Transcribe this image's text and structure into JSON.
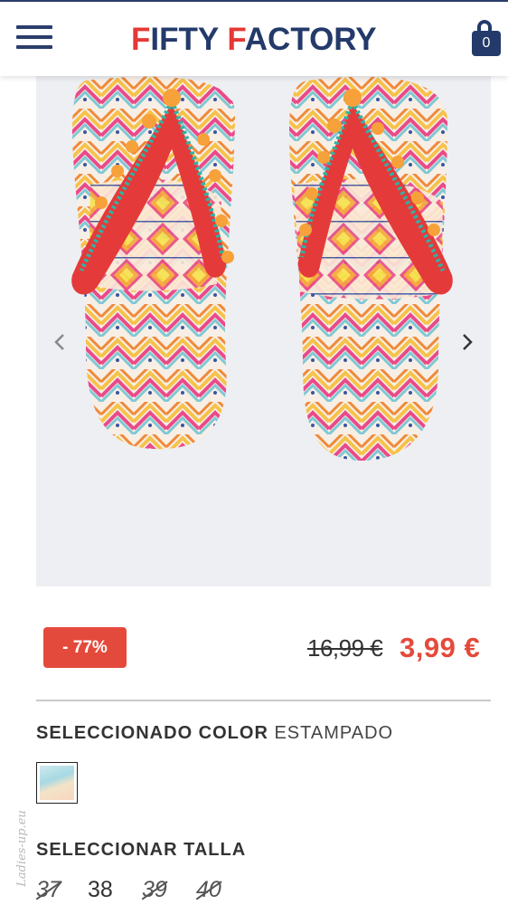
{
  "header": {
    "logo_word1_initial": "F",
    "logo_word1_rest": "IFTY ",
    "logo_word2_initial": "F",
    "logo_word2_rest": "ACTORY",
    "cart_count": "0"
  },
  "product": {
    "discount_badge": "- 77%",
    "old_price": "16,99 €",
    "new_price": "3,99 €"
  },
  "color": {
    "heading": "SELECCIONADO COLOR",
    "value": "ESTAMPADO"
  },
  "size": {
    "heading": "SELECCIONAR TALLA",
    "options": [
      {
        "label": "37",
        "available": false
      },
      {
        "label": "38",
        "available": true
      },
      {
        "label": "39",
        "available": false
      },
      {
        "label": "40",
        "available": false
      }
    ]
  },
  "watermark": "Ladies-up.eu",
  "colors": {
    "brand_navy": "#233a6a",
    "brand_red": "#e53935",
    "sale_red": "#e44a3b"
  }
}
